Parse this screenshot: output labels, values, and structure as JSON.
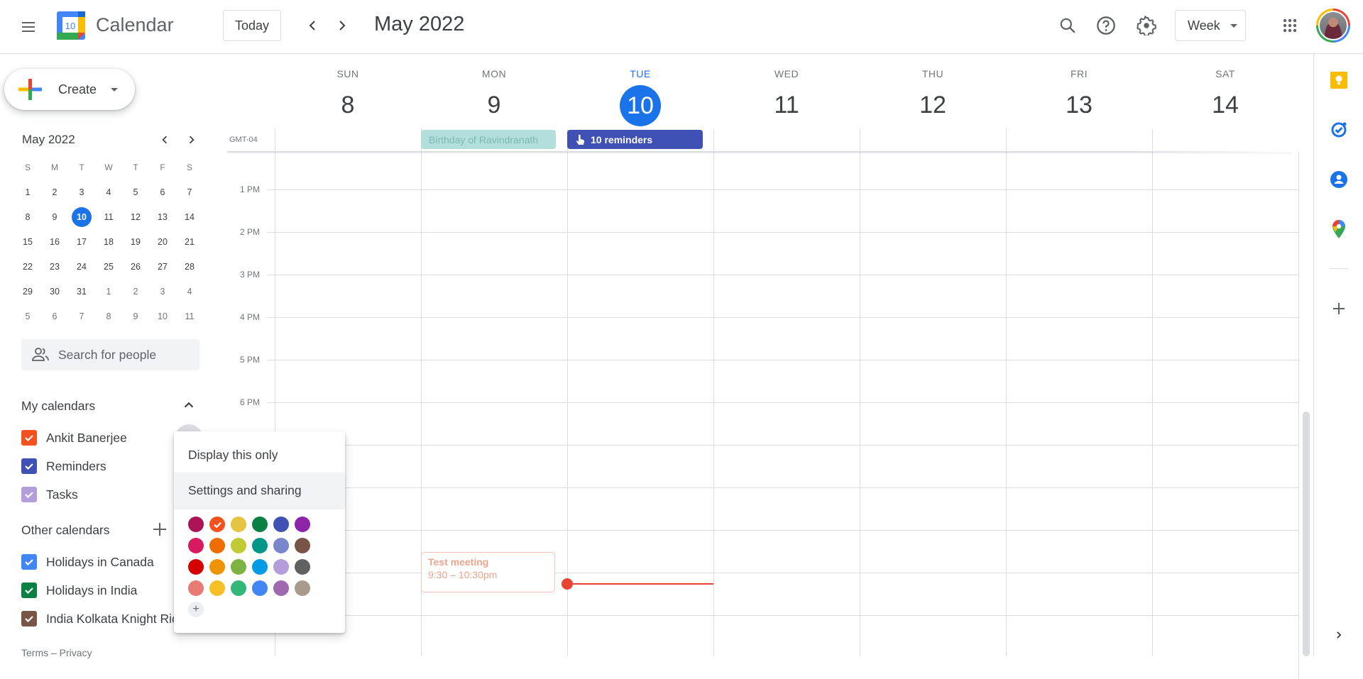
{
  "header": {
    "app_title": "Calendar",
    "logo_day": "10",
    "today_label": "Today",
    "period_title": "May 2022",
    "view_label": "Week",
    "icons": [
      "menu-icon",
      "search-icon",
      "help-icon",
      "settings-icon",
      "apps-grid-icon",
      "account-avatar"
    ]
  },
  "sidebar": {
    "create_label": "Create",
    "mini_calendar": {
      "title": "May 2022",
      "dow": [
        "S",
        "M",
        "T",
        "W",
        "T",
        "F",
        "S"
      ],
      "weeks": [
        [
          "1",
          "2",
          "3",
          "4",
          "5",
          "6",
          "7"
        ],
        [
          "8",
          "9",
          "10",
          "11",
          "12",
          "13",
          "14"
        ],
        [
          "15",
          "16",
          "17",
          "18",
          "19",
          "20",
          "21"
        ],
        [
          "22",
          "23",
          "24",
          "25",
          "26",
          "27",
          "28"
        ],
        [
          "29",
          "30",
          "31",
          "1",
          "2",
          "3",
          "4"
        ],
        [
          "5",
          "6",
          "7",
          "8",
          "9",
          "10",
          "11"
        ]
      ],
      "today": "10"
    },
    "search_people_placeholder": "Search for people",
    "my_calendars_title": "My calendars",
    "my_calendars": [
      {
        "label": "Ankit Banerjee",
        "color": "#f4511e",
        "checked": true
      },
      {
        "label": "Reminders",
        "color": "#3f51b5",
        "checked": true
      },
      {
        "label": "Tasks",
        "color": "#b39ddb",
        "checked": true
      }
    ],
    "other_calendars_title": "Other calendars",
    "other_calendars": [
      {
        "label": "Holidays in Canada",
        "color": "#4285f4",
        "checked": true
      },
      {
        "label": "Holidays in India",
        "color": "#0b8043",
        "checked": true
      },
      {
        "label": "India Kolkata Knight Ric",
        "color": "#795548",
        "checked": true
      }
    ],
    "footer": "Terms – Privacy"
  },
  "week": {
    "timezone": "GMT-04",
    "days": [
      {
        "dow": "SUN",
        "date": "8"
      },
      {
        "dow": "MON",
        "date": "9"
      },
      {
        "dow": "TUE",
        "date": "10",
        "today": true
      },
      {
        "dow": "WED",
        "date": "11"
      },
      {
        "dow": "THU",
        "date": "12"
      },
      {
        "dow": "FRI",
        "date": "13"
      },
      {
        "dow": "SAT",
        "date": "14"
      }
    ],
    "time_labels": [
      "1 PM",
      "2 PM",
      "3 PM",
      "4 PM",
      "5 PM",
      "6 PM"
    ],
    "all_day_events": [
      {
        "title": "Birthday of Ravindranath",
        "day": "MON",
        "color": "#b2dfdb",
        "text_color": "#7fb8b2"
      },
      {
        "title": "10 reminders",
        "day": "TUE",
        "color": "#3f51b5",
        "text_color": "#ffffff",
        "icon": "reminder-hand-icon"
      }
    ],
    "events": [
      {
        "title": "Test meeting",
        "time": "9:30 – 10:30pm",
        "day": "MON"
      }
    ]
  },
  "popup_menu": {
    "items": [
      "Display this only",
      "Settings and sharing"
    ],
    "selected_color": "#f4511e",
    "color_rows": [
      [
        "#ad1457",
        "#f4511e",
        "#e4c441",
        "#0b8043",
        "#3f51b5",
        "#8e24aa"
      ],
      [
        "#d81b60",
        "#ef6c00",
        "#c0ca33",
        "#009688",
        "#7986cb",
        "#795548"
      ],
      [
        "#d50000",
        "#f09300",
        "#7cb342",
        "#039be5",
        "#b39ddb",
        "#616161"
      ],
      [
        "#e67c73",
        "#f6bf26",
        "#33b679",
        "#4285f4",
        "#9e69af",
        "#a79b8e"
      ]
    ],
    "add_color_label": "+"
  },
  "side_panel": {
    "icons": [
      "keep-icon",
      "tasks-icon",
      "contacts-icon",
      "maps-icon",
      "add-addon-icon",
      "expand-panel-icon"
    ]
  }
}
